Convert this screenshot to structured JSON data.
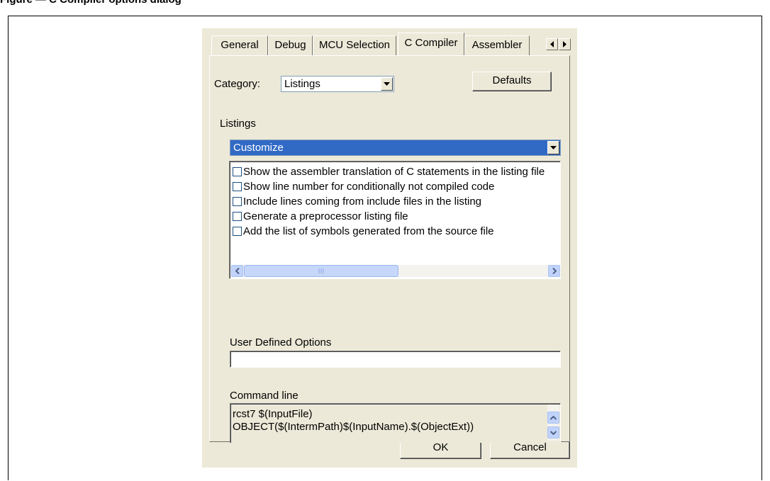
{
  "figure": {
    "caption_fragment": "Figure — C Compiler options dialog"
  },
  "tabs": [
    {
      "label": "General",
      "active": false
    },
    {
      "label": "Debug",
      "active": false
    },
    {
      "label": "MCU Selection",
      "active": false
    },
    {
      "label": "C Compiler",
      "active": true
    },
    {
      "label": "Assembler",
      "active": false
    }
  ],
  "tab_scroll": {
    "left_icon": "arrow-left-icon",
    "right_icon": "arrow-right-icon"
  },
  "category": {
    "label": "Category:",
    "value": "Listings"
  },
  "defaults_button": "Defaults",
  "listings": {
    "label": "Listings",
    "selected": "Customize",
    "options": [
      {
        "label": "Show the assembler translation of C statements in the listing file",
        "checked": false
      },
      {
        "label": "Show line number for conditionally not compiled code",
        "checked": false
      },
      {
        "label": "Include lines coming from include files in the listing",
        "checked": false
      },
      {
        "label": "Generate a preprocessor listing file",
        "checked": false
      },
      {
        "label": "Add the list of symbols generated from the source file",
        "checked": false
      }
    ]
  },
  "user_defined": {
    "label": "User Defined Options",
    "value": ""
  },
  "command_line": {
    "label": "Command line",
    "line1": "rcst7 $(InputFile)",
    "line2": "OBJECT($(IntermPath)$(InputName).$(ObjectExt))"
  },
  "ok_button": "OK",
  "cancel_button": "Cancel",
  "colors": {
    "dialog_bg": "#ece9d8",
    "selection_bg": "#316ac5",
    "selection_text": "#ffffff"
  }
}
